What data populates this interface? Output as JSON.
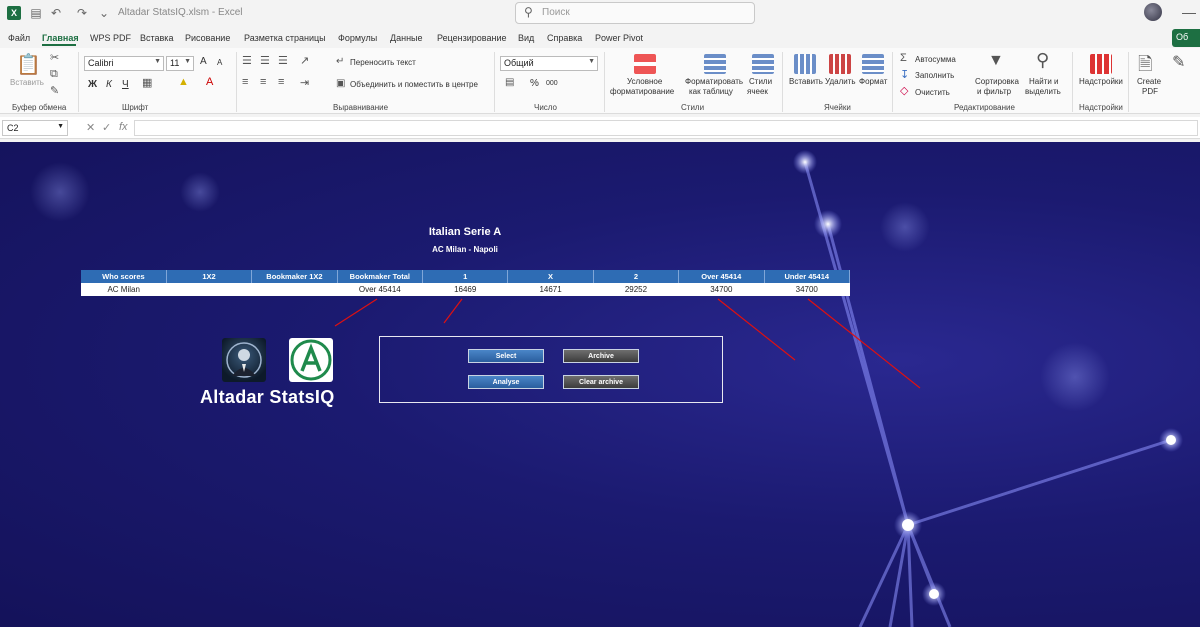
{
  "app": {
    "title": "Altadar StatsIQ.xlsm  -  Excel",
    "search_placeholder": "Поиск",
    "logo_letter": "X",
    "share_label": "Об"
  },
  "tabs": [
    "Файл",
    "Главная",
    "WPS PDF",
    "Вставка",
    "Рисование",
    "Разметка страницы",
    "Формулы",
    "Данные",
    "Рецензирование",
    "Вид",
    "Справка",
    "Power Pivot"
  ],
  "ribbon": {
    "clipboard": {
      "paste": "Вставить",
      "group": "Буфер обмена"
    },
    "font": {
      "name": "Calibri",
      "size": "11",
      "group": "Шрифт",
      "bold": "Ж",
      "italic": "К",
      "underline": "Ч",
      "grow": "A",
      "shrink": "A"
    },
    "alignment": {
      "wrap": "Переносить текст",
      "merge": "Объединить и поместить в центре",
      "group": "Выравнивание"
    },
    "number": {
      "format": "Общий",
      "percent": "%",
      "comma": "000",
      "group": "Число"
    },
    "styles": {
      "conditional_1": "Условное",
      "conditional_2": "форматирование",
      "table_1": "Форматировать",
      "table_2": "как таблицу",
      "cell_1": "Стили",
      "cell_2": "ячеек",
      "group": "Стили"
    },
    "cells": {
      "insert": "Вставить",
      "delete": "Удалить",
      "format": "Формат",
      "group": "Ячейки"
    },
    "editing": {
      "autosum": "Автосумма",
      "fill": "Заполнить",
      "clear": "Очистить",
      "sort_1": "Сортировка",
      "sort_2": "и фильтр",
      "find_1": "Найти и",
      "find_2": "выделить",
      "group": "Редактирование"
    },
    "addins": {
      "label": "Надстройки",
      "group": "Надстройки"
    },
    "pdf": {
      "label_1": "Create",
      "label_2": "PDF"
    }
  },
  "formula_bar": {
    "cell_ref": "C2",
    "fx": "fx",
    "value": ""
  },
  "dashboard": {
    "league": "Italian Serie A",
    "match": "AC Milan - Napoli",
    "table": {
      "headers": [
        "Who scores",
        "1X2",
        "Bookmaker 1X2",
        "Bookmaker Total",
        "1",
        "X",
        "2",
        "Over 45414",
        "Under 45414"
      ],
      "row": [
        "AC Milan",
        "",
        "",
        "Over 45414",
        "16469",
        "14671",
        "29252",
        "34700",
        "34700"
      ]
    },
    "brand": "Altadar StatsIQ",
    "buttons": {
      "select": "Select",
      "archive": "Archive",
      "analyse": "Analyse",
      "clear_archive": "Clear archive"
    },
    "colors": {
      "header_blue": "#2e6cb4",
      "background": "#1b1a70",
      "arrow_red": "#e01010"
    }
  }
}
